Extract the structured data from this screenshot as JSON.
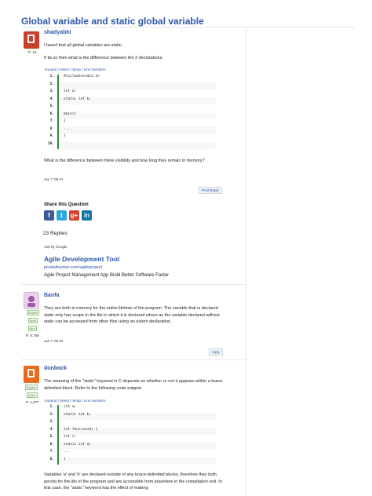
{
  "page_title": "Global variable and static global variable",
  "question": {
    "username": "shadyabhi",
    "points": "P: 15",
    "text1": "I heard that all global variables are static..",
    "text2": "If its so then what is the difference between the 2 declarations:",
    "code_toolbar": [
      "Expand",
      "Select",
      "Wrap",
      "Line Numbers"
    ],
    "code_lines": [
      {
        "n": "1.",
        "t": "#include<stdio.h>"
      },
      {
        "n": "2.",
        "t": ""
      },
      {
        "n": "3.",
        "t": "int a;"
      },
      {
        "n": "4.",
        "t": "static int b;"
      },
      {
        "n": "5.",
        "t": ""
      },
      {
        "n": "6.",
        "t": "main()"
      },
      {
        "n": "7.",
        "t": "{"
      },
      {
        "n": "8.",
        "t": "...."
      },
      {
        "n": "9.",
        "t": "}"
      },
      {
        "n": "10.",
        "t": ""
      }
    ],
    "text3": "What is the difference between there visibility and how long they remain in memory?",
    "date": "Jan 7 '09 #1",
    "reply_label": "Post Reply"
  },
  "share": {
    "heading": "Share this Question",
    "icons": [
      {
        "name": "facebook",
        "glyph": "f",
        "color": "#3b5998"
      },
      {
        "name": "twitter",
        "glyph": "t",
        "color": "#2aa9e0"
      },
      {
        "name": "google-plus",
        "glyph": "g+",
        "color": "#d23f2e"
      },
      {
        "name": "linkedin",
        "glyph": "in",
        "color": "#0e76a8"
      }
    ]
  },
  "replies_count": "23 Replies",
  "ad": {
    "ads_by": "Ads by Google",
    "title": "Agile Development Tool",
    "url": "pivotaltracker.com/agileproject",
    "desc": "Agile Project Management App Build Better Software Faster"
  },
  "reply1": {
    "username": "Banfa",
    "badges": [
      "Expert",
      "Mod",
      "8k+"
    ],
    "points": "P: 8,789",
    "text": "They are both in memory for the entire lifetime of the program. The variable that is declared static only has scope in the file in which it is declared where as the variable declared without static can be accessed from other files using an extern declaration.",
    "date": "Jan 7 '09 #2",
    "reply_label": "reply"
  },
  "reply2": {
    "username": "donbock",
    "badges": [
      "Expert",
      "2.5k+"
    ],
    "points": "P: 1,877",
    "text": "The meaning of the \"static\" keyword in C depends on whether or not it appears within a brace-delimited block. Refer to the following code snippet.",
    "code_toolbar": [
      "Expand",
      "Select",
      "Wrap",
      "Line Numbers"
    ],
    "code_lines": [
      {
        "n": "1.",
        "t": "int a;"
      },
      {
        "n": "2.",
        "t": "static int b;"
      },
      {
        "n": "3.",
        "t": ""
      },
      {
        "n": "4.",
        "t": "int func(void) {"
      },
      {
        "n": "5.",
        "t": "   int c;"
      },
      {
        "n": "6.",
        "t": "   static int d;"
      },
      {
        "n": "7.",
        "t": "   ..."
      },
      {
        "n": "8.",
        "t": "}"
      }
    ],
    "text2": "Variables 'a' and 'b' are declared outside of any brace-delimited blocks, therefore they both persist for the life of the program and are accessible from anywhere in the compilation unit. In this case, the \"static\" keyword has the effect of making"
  }
}
